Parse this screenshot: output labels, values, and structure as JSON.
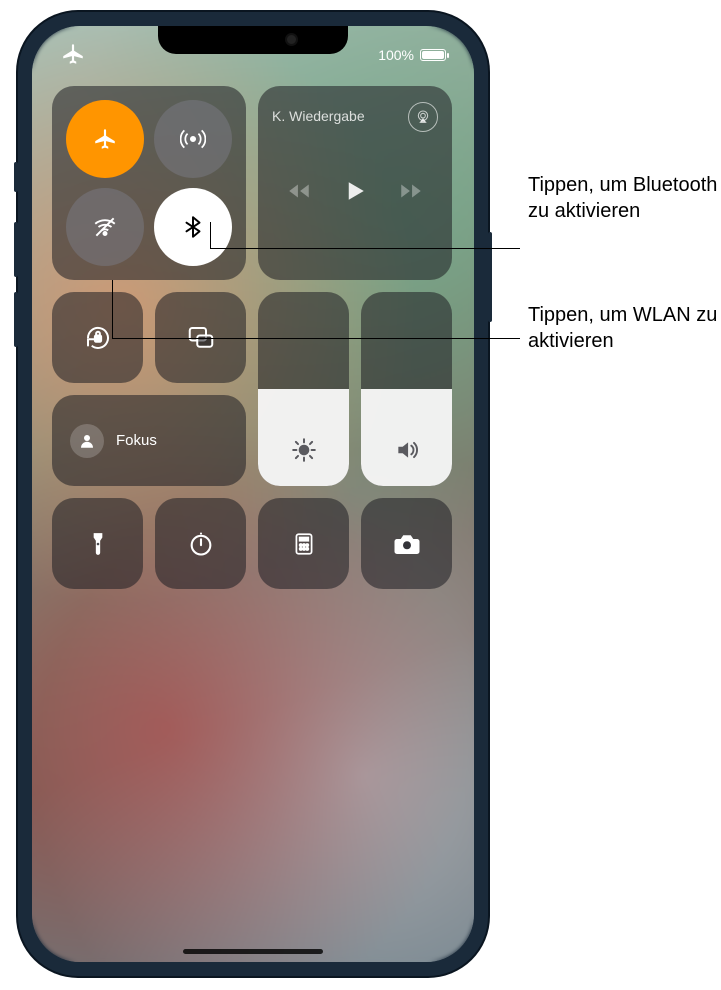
{
  "status": {
    "battery_pct": "100%"
  },
  "connectivity": {
    "airplane": {
      "on": true
    },
    "cellular": {
      "on": false
    },
    "wifi": {
      "on": false
    },
    "bluetooth": {
      "on": true
    }
  },
  "media": {
    "title": "K. Wiedergabe"
  },
  "focus": {
    "label": "Fokus"
  },
  "brightness": {
    "level_pct": 50
  },
  "volume": {
    "level_pct": 50
  },
  "callouts": {
    "bluetooth": "Tippen, um Bluetooth zu aktivieren",
    "wifi": "Tippen, um WLAN zu aktivieren"
  }
}
